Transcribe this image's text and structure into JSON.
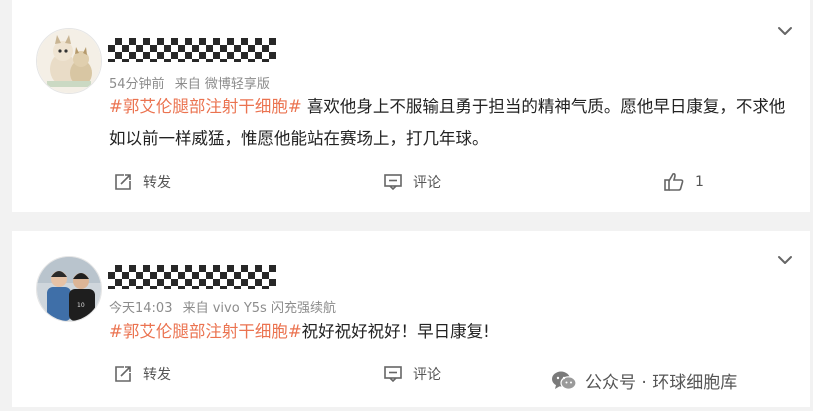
{
  "comments": [
    {
      "time": "54分钟前",
      "source": "来自 微博轻享版",
      "topic": "#郭艾伦腿部注射干细胞#",
      "text": " 喜欢他身上不服输且勇于担当的精神气质。愿他早日康复，不求他如以前一样威猛，惟愿他能站在赛场上，打几年球。",
      "repost_label": "转发",
      "comment_label": "评论",
      "like_count": "1"
    },
    {
      "time": "今天14:03",
      "source": "来自 vivo Y5s 闪充强续航",
      "topic": "#郭艾伦腿部注射干细胞#",
      "text": "祝好祝好祝好！早日康复!",
      "repost_label": "转发",
      "comment_label": "评论"
    }
  ],
  "watermark": {
    "text": "公众号 · 环球细胞库"
  },
  "icons": {
    "chevron": "chevron-down-icon",
    "repost": "repost-icon",
    "comment": "comment-icon",
    "like": "thumbs-up-icon",
    "wechat": "wechat-icon"
  },
  "colors": {
    "topic": "#eb7350",
    "meta": "#8c8c8c",
    "background": "#f2f2f2"
  }
}
